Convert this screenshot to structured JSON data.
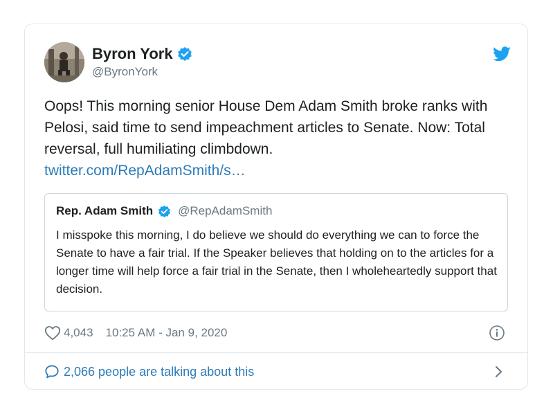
{
  "tweet": {
    "author": {
      "name": "Byron York",
      "handle": "@ByronYork"
    },
    "text": "Oops! This morning senior House Dem Adam Smith broke ranks with Pelosi, said time to send impeachment articles to Senate. Now: Total reversal, full humiliating climbdown.",
    "link": "twitter.com/RepAdamSmith/s…",
    "quoted": {
      "name": "Rep. Adam Smith",
      "handle": "@RepAdamSmith",
      "text": "I misspoke this morning, I do believe we should do everything we can to force the Senate to have a fair trial.  If the Speaker believes that holding on to the articles for a longer time will help force a fair trial in the Senate, then I wholeheartedly support that decision."
    },
    "likes": "4,043",
    "timestamp": "10:25 AM - Jan 9, 2020",
    "conversation": "2,066 people are talking about this"
  },
  "icons": {
    "verified": "verified-badge-icon",
    "bird": "twitter-bird-icon",
    "heart": "heart-icon",
    "info": "info-icon",
    "comment": "comment-bubble-icon",
    "chevron": "chevron-right-icon"
  },
  "colors": {
    "accent": "#1da1f2",
    "link": "#2b7bb9",
    "muted": "#697882",
    "text": "#1c2022",
    "border": "#e1e8ed"
  }
}
